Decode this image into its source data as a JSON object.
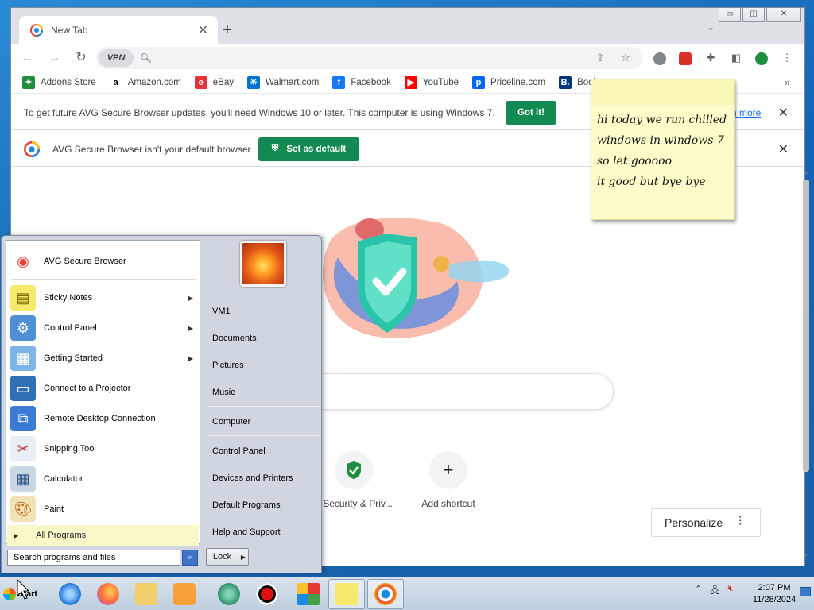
{
  "browser": {
    "tab_title": "New Tab",
    "tab_close": "✕",
    "new_tab": "+",
    "vpn_label": "VPN",
    "search_placeholder": "",
    "bookmarks": [
      {
        "label": "Addons Store",
        "icon": "addons-store-icon",
        "color": "#1e8e3e",
        "glyph": "✦"
      },
      {
        "label": "Amazon.com",
        "icon": "amazon-icon",
        "color": "#ffffff",
        "glyph": "a"
      },
      {
        "label": "eBay",
        "icon": "ebay-icon",
        "color": "#e53238",
        "glyph": "e"
      },
      {
        "label": "Walmart.com",
        "icon": "walmart-icon",
        "color": "#0071ce",
        "glyph": "✳"
      },
      {
        "label": "Facebook",
        "icon": "facebook-icon",
        "color": "#1877f2",
        "glyph": "f"
      },
      {
        "label": "YouTube",
        "icon": "youtube-icon",
        "color": "#ff0000",
        "glyph": "▶"
      },
      {
        "label": "Priceline.com",
        "icon": "priceline-icon",
        "color": "#0068ef",
        "glyph": "p"
      },
      {
        "label": "Booking.c",
        "icon": "booking-icon",
        "color": "#003580",
        "glyph": "B."
      }
    ],
    "bookmarks_more": "»",
    "infobar1": {
      "message": "To get future AVG Secure Browser updates, you'll need Windows 10 or later. This computer is using Windows 7.",
      "button": "Got it!",
      "learn_more": "n more",
      "close": "✕"
    },
    "infobar2": {
      "message": "AVG Secure Browser isn't your default browser",
      "button": "Set as default",
      "close": "✕"
    },
    "shortcuts": [
      {
        "label": "Security & Priv...",
        "icon": "shield-check-icon"
      },
      {
        "label": "Add shortcut",
        "icon": "plus-icon"
      }
    ],
    "personalize": "Personalize",
    "accent_green": "#128a52"
  },
  "sticky_note": {
    "text": "hi today we run chilled windows in windows 7 so let gooooo\nit good but bye bye"
  },
  "start_menu": {
    "pinned": [
      {
        "label": "AVG Secure Browser",
        "icon": "avg-browser-icon",
        "arrow": false
      },
      {
        "label": "Sticky Notes",
        "icon": "sticky-notes-icon",
        "arrow": true
      },
      {
        "label": "Control Panel",
        "icon": "control-panel-icon",
        "arrow": true
      },
      {
        "label": "Getting Started",
        "icon": "getting-started-icon",
        "arrow": true
      },
      {
        "label": "Connect to a Projector",
        "icon": "projector-icon",
        "arrow": false
      },
      {
        "label": "Remote Desktop Connection",
        "icon": "remote-desktop-icon",
        "arrow": false
      },
      {
        "label": "Snipping Tool",
        "icon": "snipping-tool-icon",
        "arrow": false
      },
      {
        "label": "Calculator",
        "icon": "calculator-icon",
        "arrow": false
      },
      {
        "label": "Paint",
        "icon": "paint-icon",
        "arrow": false
      }
    ],
    "all_programs": "All Programs",
    "search_placeholder": "Search programs and files",
    "right_items": [
      "VM1",
      "Documents",
      "Pictures",
      "Music",
      "Computer",
      "Control Panel",
      "Devices and Printers",
      "Default Programs",
      "Help and Support"
    ],
    "lock_label": "Lock"
  },
  "taskbar": {
    "start_label": "Start",
    "time": "2:07 PM",
    "date": "11/28/2024",
    "apps": [
      "internet-explorer-icon",
      "firefox-icon",
      "file-explorer-icon",
      "media-player-icon",
      "green-app-icon",
      "record-icon",
      "avg-antivirus-icon",
      "sticky-notes-icon",
      "avg-browser-icon"
    ]
  }
}
